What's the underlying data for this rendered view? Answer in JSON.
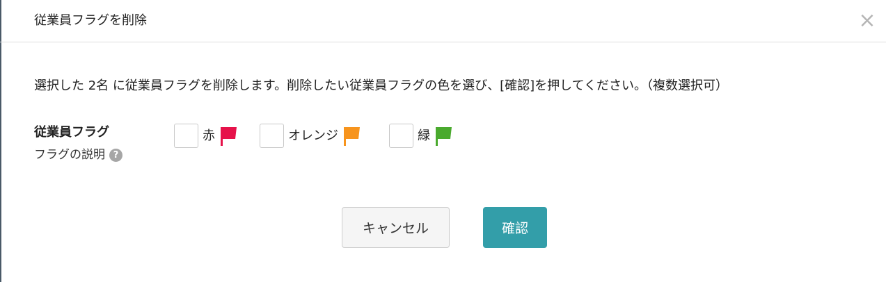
{
  "dialog": {
    "title": "従業員フラグを削除",
    "close_icon": "close-icon"
  },
  "message": "選択した 2名 に従業員フラグを削除します。削除したい従業員フラグの色を選び、[確認]を押してください。（複数選択可）",
  "flag_field": {
    "label": "従業員フラグ",
    "help_text": "フラグの説明",
    "help_icon": "question-circle-icon",
    "options": [
      {
        "label": "赤",
        "color": "#e6124a",
        "checked": false
      },
      {
        "label": "オレンジ",
        "color": "#f7941d",
        "checked": false
      },
      {
        "label": "緑",
        "color": "#4aaa2e",
        "checked": false
      }
    ]
  },
  "buttons": {
    "cancel": "キャンセル",
    "confirm": "確認"
  },
  "colors": {
    "primary": "#339ea9",
    "cancel_bg": "#f5f5f5"
  }
}
